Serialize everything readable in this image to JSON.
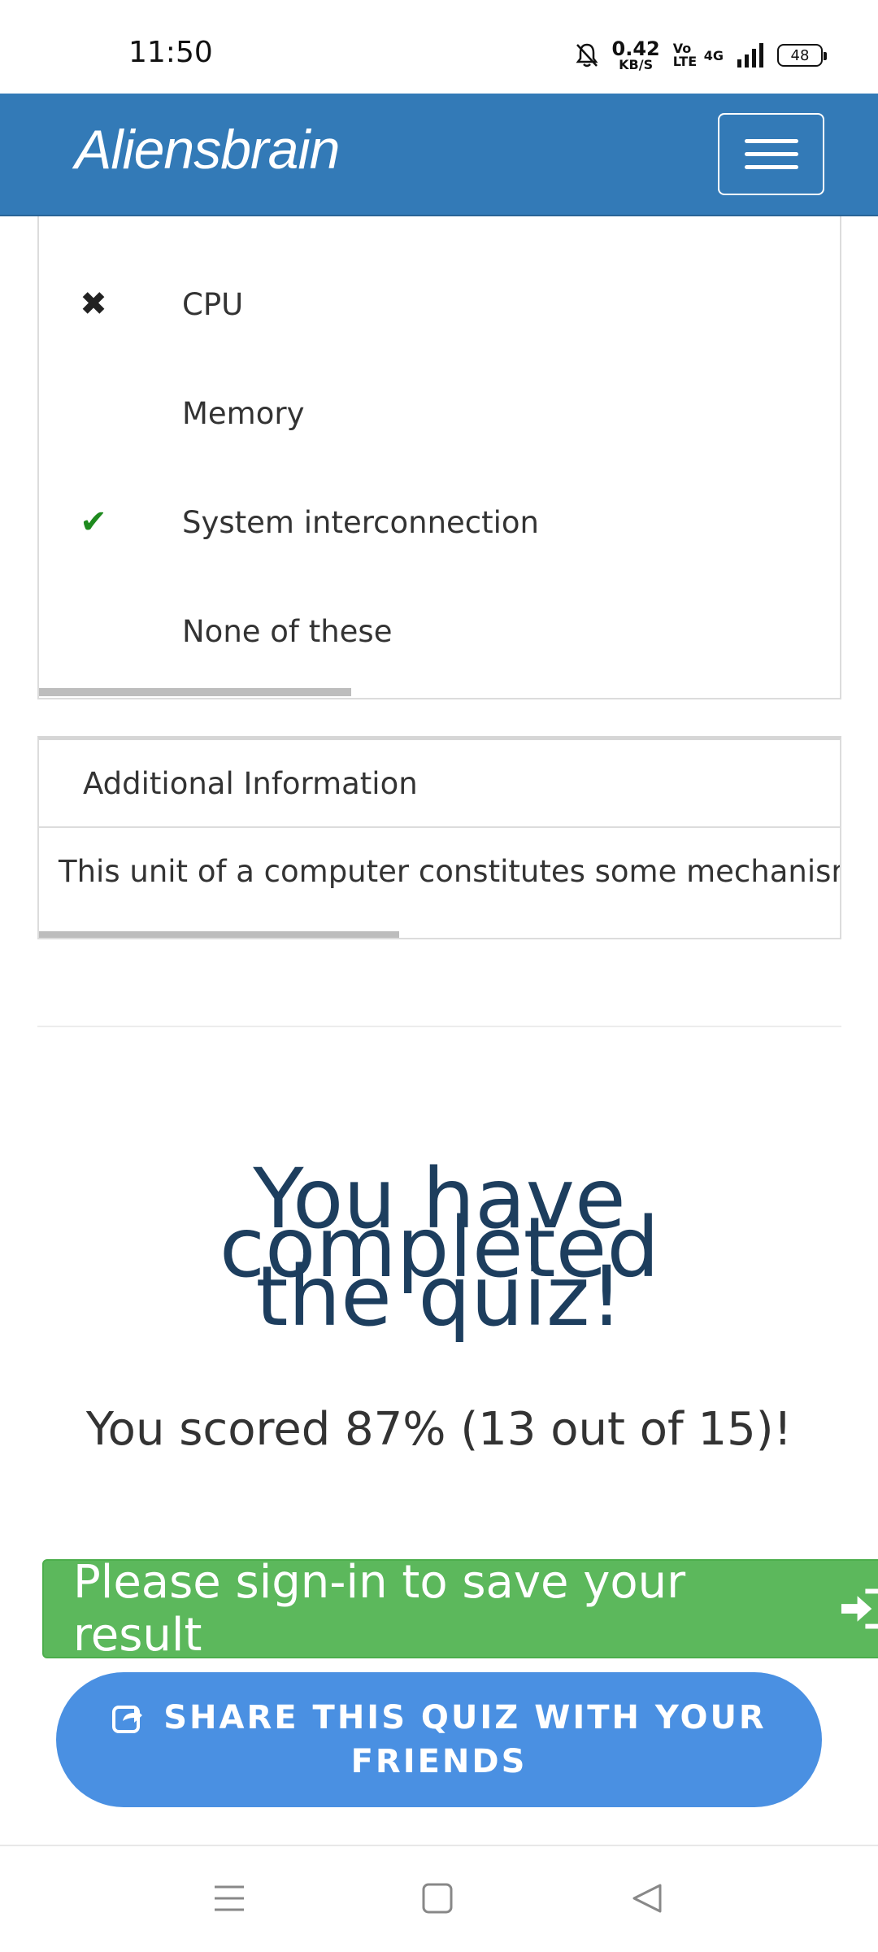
{
  "status_bar": {
    "time": "11:50",
    "net_speed_value": "0.42",
    "net_speed_unit": "KB/S",
    "volte": "Vo LTE",
    "network": "4G",
    "battery": "48"
  },
  "navbar": {
    "brand": "Aliensbrain",
    "menu_icon": "hamburger-icon"
  },
  "answers": [
    {
      "label": "CPU",
      "mark": "wrong"
    },
    {
      "label": "Memory",
      "mark": "none"
    },
    {
      "label": "System interconnection",
      "mark": "correct"
    },
    {
      "label": "None of these",
      "mark": "none"
    }
  ],
  "answers_scroll_fraction": 0.39,
  "additional_info": {
    "heading": "Additional Information",
    "body": "This unit of a computer constitutes some mechanism",
    "scroll_fraction": 0.45
  },
  "result": {
    "title_line1": "You have completed",
    "title_line2": "the quiz!",
    "score_text": "You scored 87% (13 out of 15)!"
  },
  "actions": {
    "signin_label": "Please sign-in to save your result",
    "share_label_line1": "SHARE THIS QUIZ WITH YOUR",
    "share_label_line2": "FRIENDS"
  },
  "colors": {
    "navbar": "#337ab7",
    "signin": "#5cb85c",
    "share": "#4a90e2",
    "title": "#1d3e5e",
    "correct": "#1e8a1e"
  }
}
